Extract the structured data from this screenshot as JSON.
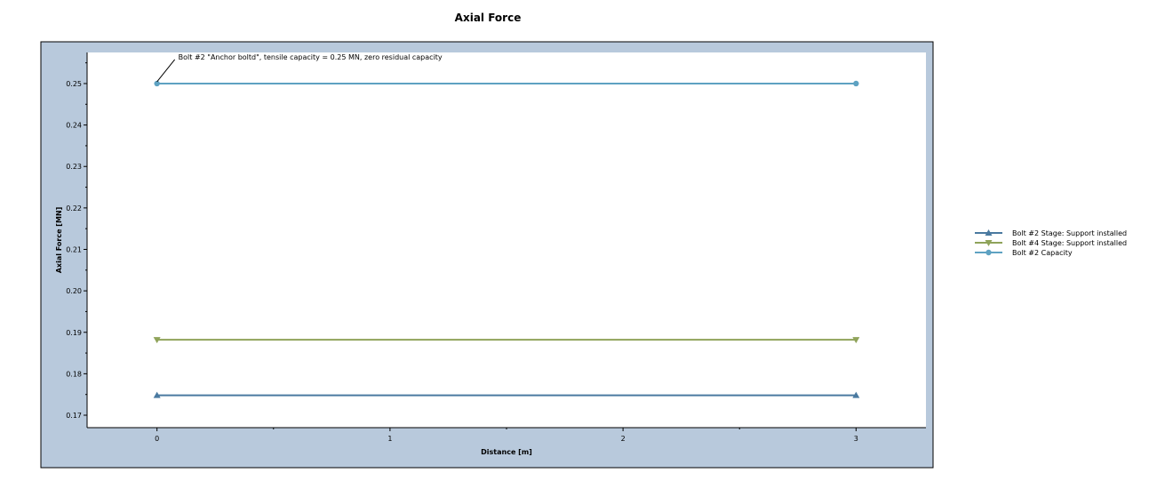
{
  "chart_data": {
    "type": "line",
    "title": "Axial Force",
    "xlabel": "Distance [m]",
    "ylabel": "Axial Force [MN]",
    "xlim": [
      -0.3,
      3.3
    ],
    "ylim": [
      0.167,
      0.2575
    ],
    "xticks": [
      0,
      1,
      2,
      3
    ],
    "xtick_labels": [
      "0",
      "1",
      "2",
      "3"
    ],
    "yticks": [
      0.17,
      0.18,
      0.19,
      0.2,
      0.21,
      0.22,
      0.23,
      0.24,
      0.25
    ],
    "ytick_labels": [
      "0.17",
      "0.18",
      "0.19",
      "0.20",
      "0.21",
      "0.22",
      "0.23",
      "0.24",
      "0.25"
    ],
    "grid": false,
    "legend_position": "right",
    "series": [
      {
        "name": "Bolt #2 Stage: Support installed",
        "x": [
          0,
          3
        ],
        "y": [
          0.1748,
          0.1748
        ],
        "color": "#4a7aa0",
        "marker": "triangle-up"
      },
      {
        "name": "Bolt #4 Stage: Support installed",
        "x": [
          0,
          3
        ],
        "y": [
          0.1882,
          0.1882
        ],
        "color": "#8fa35a",
        "marker": "triangle-down"
      },
      {
        "name": "Bolt #2 Capacity",
        "x": [
          0,
          3
        ],
        "y": [
          0.25,
          0.25
        ],
        "color": "#5ea2c2",
        "marker": "circle"
      }
    ],
    "annotations": [
      {
        "text": "Bolt #2 \"Anchor boltd\", tensile capacity = 0.25 MN, zero residual capacity",
        "x": 0,
        "y": 0.25
      }
    ]
  },
  "colors": {
    "plot_frame_bg": "#b8c9dc",
    "plot_area_bg": "#ffffff",
    "axis_color": "#000000"
  }
}
